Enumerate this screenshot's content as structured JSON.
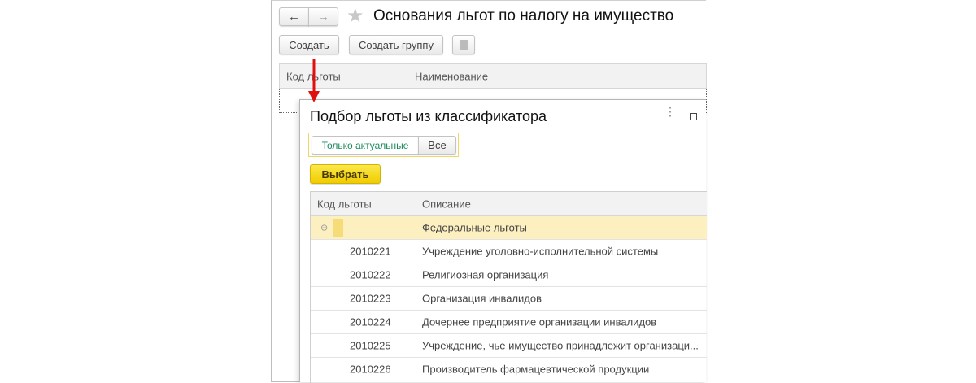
{
  "main_window": {
    "title": "Основания льгот по налогу на имущество",
    "toolbar": {
      "create_label": "Создать",
      "create_group_label": "Создать группу"
    },
    "table": {
      "columns": [
        "Код льготы",
        "Наименование"
      ]
    }
  },
  "dialog": {
    "title": "Подбор льготы из классификатора",
    "filter": {
      "options": [
        "Только актуальные",
        "Все"
      ],
      "selected": "Только актуальные"
    },
    "select_label": "Выбрать",
    "table": {
      "columns": [
        "Код льготы",
        "Описание"
      ],
      "group": "Федеральные льготы",
      "rows": [
        {
          "code": "2010221",
          "description": "Учреждение уголовно-исполнительной системы"
        },
        {
          "code": "2010222",
          "description": "Религиозная организация"
        },
        {
          "code": "2010223",
          "description": "Организация инвалидов"
        },
        {
          "code": "2010224",
          "description": "Дочернее предприятие организации инвалидов"
        },
        {
          "code": "2010225",
          "description": "Учреждение, чье имущество принадлежит организаци..."
        },
        {
          "code": "2010226",
          "description": "Производитель фармацевтической продукции"
        }
      ]
    }
  },
  "colors": {
    "accent_yellow": "#f5d90a",
    "highlight_row": "#fcefc0",
    "arrow": "#e01010",
    "toggle_green": "#1a8a5a"
  }
}
